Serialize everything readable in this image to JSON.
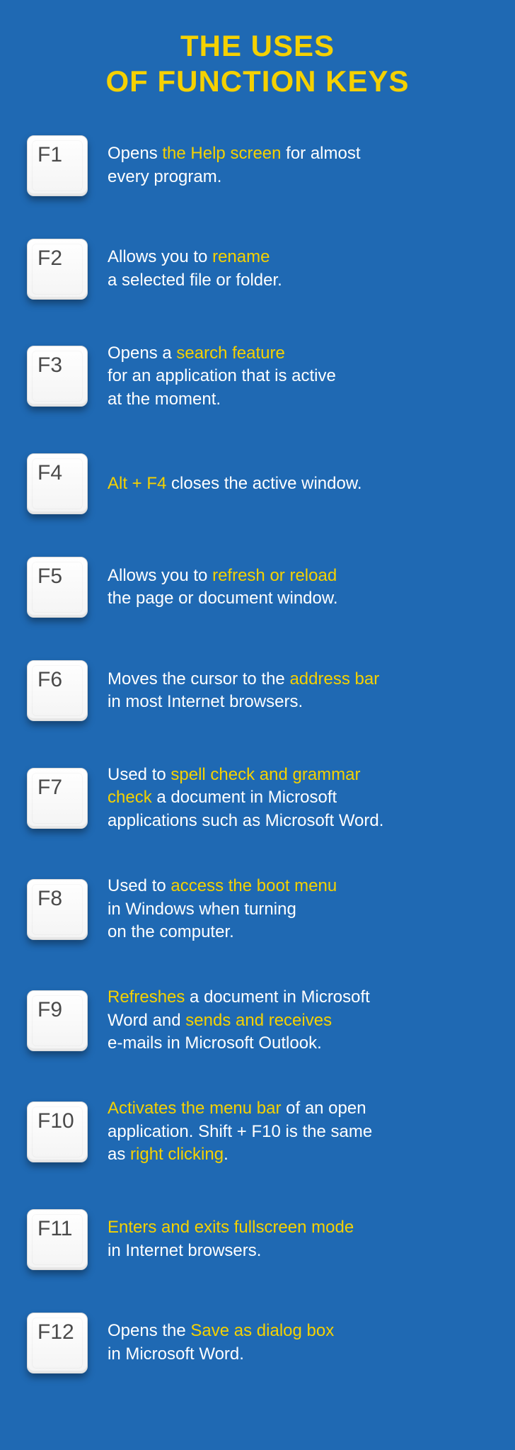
{
  "title_line1": "THE USES",
  "title_line2": "OF FUNCTION KEYS",
  "items": [
    {
      "key": "F1",
      "parts": [
        {
          "t": "Opens "
        },
        {
          "t": "the Help screen",
          "hl": true
        },
        {
          "t": " for almost"
        },
        {
          "br": true
        },
        {
          "t": "every program."
        }
      ]
    },
    {
      "key": "F2",
      "parts": [
        {
          "t": "Allows you to "
        },
        {
          "t": "rename",
          "hl": true
        },
        {
          "br": true
        },
        {
          "t": "a selected file or folder."
        }
      ]
    },
    {
      "key": "F3",
      "parts": [
        {
          "t": "Opens a "
        },
        {
          "t": "search feature",
          "hl": true
        },
        {
          "br": true
        },
        {
          "t": "for an application that is active"
        },
        {
          "br": true
        },
        {
          "t": "at the moment."
        }
      ]
    },
    {
      "key": "F4",
      "parts": [
        {
          "t": "Alt + F4",
          "hl": true
        },
        {
          "t": " closes the active window."
        }
      ]
    },
    {
      "key": "F5",
      "parts": [
        {
          "t": "Allows you to "
        },
        {
          "t": "refresh or reload",
          "hl": true
        },
        {
          "br": true
        },
        {
          "t": "the page or document window."
        }
      ]
    },
    {
      "key": "F6",
      "parts": [
        {
          "t": "Moves the cursor to the "
        },
        {
          "t": "address bar",
          "hl": true
        },
        {
          "br": true
        },
        {
          "t": "in most Internet browsers."
        }
      ]
    },
    {
      "key": "F7",
      "parts": [
        {
          "t": "Used to "
        },
        {
          "t": "spell check and grammar",
          "hl": true
        },
        {
          "br": true
        },
        {
          "t": "check",
          "hl": true
        },
        {
          "t": " a document in Microsoft"
        },
        {
          "br": true
        },
        {
          "t": "applications such as Microsoft Word."
        }
      ]
    },
    {
      "key": "F8",
      "parts": [
        {
          "t": "Used to "
        },
        {
          "t": "access the boot menu",
          "hl": true
        },
        {
          "br": true
        },
        {
          "t": "in Windows when turning"
        },
        {
          "br": true
        },
        {
          "t": "on the computer."
        }
      ]
    },
    {
      "key": "F9",
      "parts": [
        {
          "t": "Refreshes",
          "hl": true
        },
        {
          "t": " a document in Microsoft"
        },
        {
          "br": true
        },
        {
          "t": "Word and "
        },
        {
          "t": "sends and receives",
          "hl": true
        },
        {
          "br": true
        },
        {
          "t": "e-mails in Microsoft Outlook."
        }
      ]
    },
    {
      "key": "F10",
      "parts": [
        {
          "t": "Activates the menu bar",
          "hl": true
        },
        {
          "t": " of an open"
        },
        {
          "br": true
        },
        {
          "t": "application. Shift + F10 is the same"
        },
        {
          "br": true
        },
        {
          "t": "as "
        },
        {
          "t": "right clicking",
          "hl": true
        },
        {
          "t": "."
        }
      ]
    },
    {
      "key": "F11",
      "parts": [
        {
          "t": "Enters and exits fullscreen mode",
          "hl": true
        },
        {
          "br": true
        },
        {
          "t": "in Internet browsers."
        }
      ]
    },
    {
      "key": "F12",
      "parts": [
        {
          "t": "Opens the "
        },
        {
          "t": "Save as dialog box",
          "hl": true
        },
        {
          "br": true
        },
        {
          "t": "in Microsoft Word."
        }
      ]
    }
  ]
}
